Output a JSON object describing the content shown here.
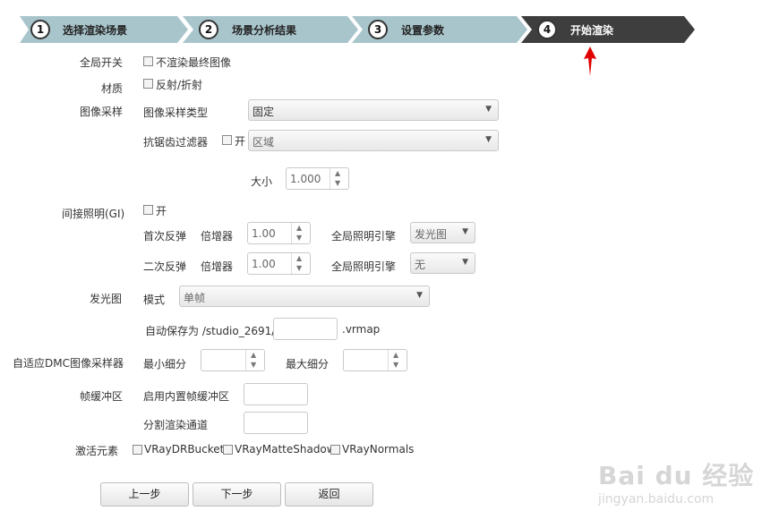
{
  "steps": [
    {
      "num": "1",
      "label": "选择渲染场景"
    },
    {
      "num": "2",
      "label": "场景分析结果"
    },
    {
      "num": "3",
      "label": "设置参数"
    },
    {
      "num": "4",
      "label": "开始渲染"
    }
  ],
  "colors": {
    "step_inactive": "#a9c5cc",
    "step_active": "#3e3e3e",
    "pointer_arrow": "#e00000"
  },
  "global": {
    "label": "全局开关",
    "option": "不渲染最终图像"
  },
  "material": {
    "label": "材质",
    "option": "反射/折射"
  },
  "image_sampler": {
    "label": "图像采样",
    "type_label": "图像采样类型",
    "type_value": "固定",
    "aa_label": "抗锯齿过滤器",
    "aa_on_label": "开",
    "aa_filter_value": "区域",
    "size_label": "大小",
    "size_value": "1.000"
  },
  "gi": {
    "label": "间接照明(GI)",
    "on_label": "开",
    "primary_label": "首次反弹",
    "secondary_label": "二次反弹",
    "multiplier_label": "倍增器",
    "primary_multiplier": "1.00",
    "secondary_multiplier": "1.00",
    "engine_label": "全局照明引擎",
    "primary_engine": "发光图",
    "secondary_engine": "无"
  },
  "irradiance": {
    "label": "发光图",
    "mode_label": "模式",
    "mode_value": "单帧",
    "autosave_label": "自动保存为 /studio_2691/",
    "autosave_suffix": ".vrmap"
  },
  "dmc": {
    "label": "自适应DMC图像采样器",
    "min_label": "最小细分",
    "max_label": "最大细分"
  },
  "framebuffer": {
    "label": "帧缓冲区",
    "builtin_label": "启用内置帧缓冲区",
    "split_label": "分割渲染通道"
  },
  "elements": {
    "label": "激活元素",
    "items": [
      "VRayDRBucket",
      "VRayMatteShadow",
      "VRayNormals"
    ]
  },
  "buttons": {
    "prev": "上一步",
    "next": "下一步",
    "back": "返回"
  },
  "watermark": {
    "brand": "Bai du 经验",
    "url": "jingyan.baidu.com"
  }
}
